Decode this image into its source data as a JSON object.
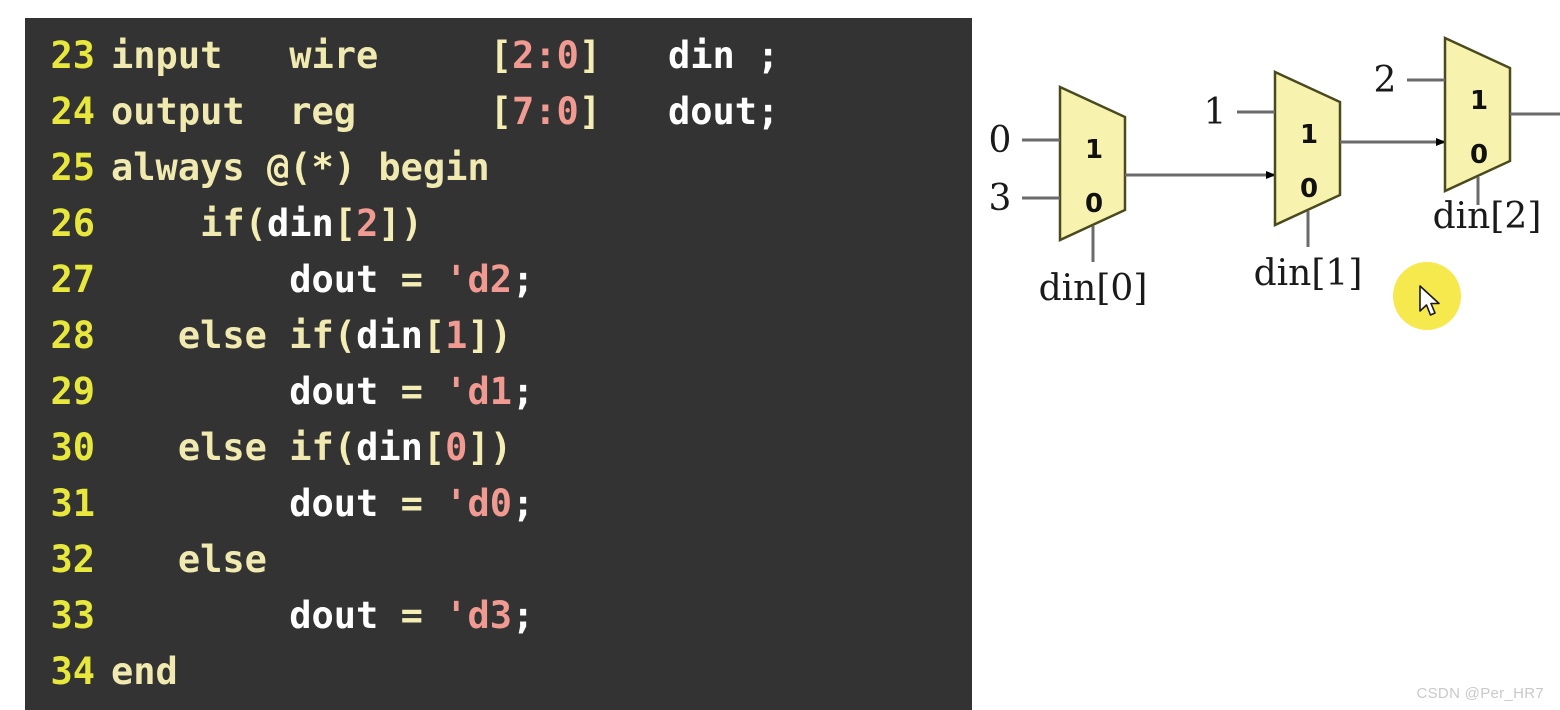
{
  "code": {
    "language": "verilog",
    "background_color": "#333333",
    "line_number_color": "#e8e83c",
    "lines": [
      {
        "number": "23",
        "text": "input   wire     [2:0]   din ;",
        "tokens": [
          {
            "t": "input",
            "c": "kw"
          },
          {
            "t": "   ",
            "c": "plain"
          },
          {
            "t": "wire",
            "c": "kw"
          },
          {
            "t": "     ",
            "c": "plain"
          },
          {
            "t": "[",
            "c": "br"
          },
          {
            "t": "2",
            "c": "num"
          },
          {
            "t": ":",
            "c": "num"
          },
          {
            "t": "0",
            "c": "num"
          },
          {
            "t": "]",
            "c": "br"
          },
          {
            "t": "   ",
            "c": "plain"
          },
          {
            "t": "din ;",
            "c": "id"
          }
        ]
      },
      {
        "number": "24",
        "text": "output  reg      [7:0]   dout;",
        "tokens": [
          {
            "t": "output",
            "c": "kw"
          },
          {
            "t": "  ",
            "c": "plain"
          },
          {
            "t": "reg",
            "c": "kw"
          },
          {
            "t": "      ",
            "c": "plain"
          },
          {
            "t": "[",
            "c": "br"
          },
          {
            "t": "7",
            "c": "num"
          },
          {
            "t": ":",
            "c": "num"
          },
          {
            "t": "0",
            "c": "num"
          },
          {
            "t": "]",
            "c": "br"
          },
          {
            "t": "   ",
            "c": "plain"
          },
          {
            "t": "dout;",
            "c": "id"
          }
        ]
      },
      {
        "number": "25",
        "text": "always @(*) begin",
        "tokens": [
          {
            "t": "always ",
            "c": "kw"
          },
          {
            "t": "@(*)",
            "c": "br"
          },
          {
            "t": " ",
            "c": "plain"
          },
          {
            "t": "begin",
            "c": "kw"
          }
        ]
      },
      {
        "number": "26",
        "text": "    if(din[2])",
        "tokens": [
          {
            "t": "    ",
            "c": "plain"
          },
          {
            "t": "if",
            "c": "kw"
          },
          {
            "t": "(",
            "c": "br"
          },
          {
            "t": "din",
            "c": "id"
          },
          {
            "t": "[",
            "c": "br"
          },
          {
            "t": "2",
            "c": "num"
          },
          {
            "t": "]",
            "c": "br"
          },
          {
            "t": ")",
            "c": "br"
          }
        ]
      },
      {
        "number": "27",
        "text": "        dout = 'd2;",
        "tokens": [
          {
            "t": "        ",
            "c": "plain"
          },
          {
            "t": "dout",
            "c": "id"
          },
          {
            "t": " ",
            "c": "plain"
          },
          {
            "t": "=",
            "c": "op"
          },
          {
            "t": " ",
            "c": "plain"
          },
          {
            "t": "'d2",
            "c": "num"
          },
          {
            "t": ";",
            "c": "punc"
          }
        ]
      },
      {
        "number": "28",
        "text": "   else if(din[1])",
        "tokens": [
          {
            "t": "   ",
            "c": "plain"
          },
          {
            "t": "else ",
            "c": "kw"
          },
          {
            "t": "if",
            "c": "kw"
          },
          {
            "t": "(",
            "c": "br"
          },
          {
            "t": "din",
            "c": "id"
          },
          {
            "t": "[",
            "c": "br"
          },
          {
            "t": "1",
            "c": "num"
          },
          {
            "t": "]",
            "c": "br"
          },
          {
            "t": ")",
            "c": "br"
          }
        ]
      },
      {
        "number": "29",
        "text": "        dout = 'd1;",
        "tokens": [
          {
            "t": "        ",
            "c": "plain"
          },
          {
            "t": "dout",
            "c": "id"
          },
          {
            "t": " ",
            "c": "plain"
          },
          {
            "t": "=",
            "c": "op"
          },
          {
            "t": " ",
            "c": "plain"
          },
          {
            "t": "'d1",
            "c": "num"
          },
          {
            "t": ";",
            "c": "punc"
          }
        ]
      },
      {
        "number": "30",
        "text": "   else if(din[0])",
        "tokens": [
          {
            "t": "   ",
            "c": "plain"
          },
          {
            "t": "else ",
            "c": "kw"
          },
          {
            "t": "if",
            "c": "kw"
          },
          {
            "t": "(",
            "c": "br"
          },
          {
            "t": "din",
            "c": "id"
          },
          {
            "t": "[",
            "c": "br"
          },
          {
            "t": "0",
            "c": "num"
          },
          {
            "t": "]",
            "c": "br"
          },
          {
            "t": ")",
            "c": "br"
          }
        ]
      },
      {
        "number": "31",
        "text": "        dout = 'd0;",
        "tokens": [
          {
            "t": "        ",
            "c": "plain"
          },
          {
            "t": "dout",
            "c": "id"
          },
          {
            "t": " ",
            "c": "plain"
          },
          {
            "t": "=",
            "c": "op"
          },
          {
            "t": " ",
            "c": "plain"
          },
          {
            "t": "'d0",
            "c": "num"
          },
          {
            "t": ";",
            "c": "punc"
          }
        ]
      },
      {
        "number": "32",
        "text": "   else",
        "tokens": [
          {
            "t": "   ",
            "c": "plain"
          },
          {
            "t": "else",
            "c": "kw"
          }
        ]
      },
      {
        "number": "33",
        "text": "        dout = 'd3;",
        "tokens": [
          {
            "t": "        ",
            "c": "plain"
          },
          {
            "t": "dout",
            "c": "id"
          },
          {
            "t": " ",
            "c": "plain"
          },
          {
            "t": "=",
            "c": "op"
          },
          {
            "t": " ",
            "c": "plain"
          },
          {
            "t": "'d3",
            "c": "num"
          },
          {
            "t": ";",
            "c": "punc"
          }
        ]
      },
      {
        "number": "34",
        "text": "end",
        "tokens": [
          {
            "t": "end",
            "c": "kw"
          }
        ]
      }
    ]
  },
  "diagram": {
    "title": "priority-mux-chain",
    "mux_fill_color": "#f7f3ae",
    "mux_stroke_color": "#4a4a1e",
    "wire_color": "#6b6b6b",
    "muxes": [
      {
        "id": "mux-0",
        "select_label": "din[0]",
        "pin_high_label": "1",
        "pin_low_label": "0",
        "input_high_value": "0",
        "input_low_value": "3"
      },
      {
        "id": "mux-1",
        "select_label": "din[1]",
        "pin_high_label": "1",
        "pin_low_label": "0",
        "input_high_value": "1",
        "input_low_value": ""
      },
      {
        "id": "mux-2",
        "select_label": "din[2]",
        "pin_high_label": "1",
        "pin_low_label": "0",
        "input_high_value": "2",
        "input_low_value": ""
      }
    ]
  },
  "cursor": {
    "highlight_color": "#f5e94e"
  },
  "watermark": {
    "text": "CSDN @Per_HR7",
    "color": "#c9c9c9"
  }
}
